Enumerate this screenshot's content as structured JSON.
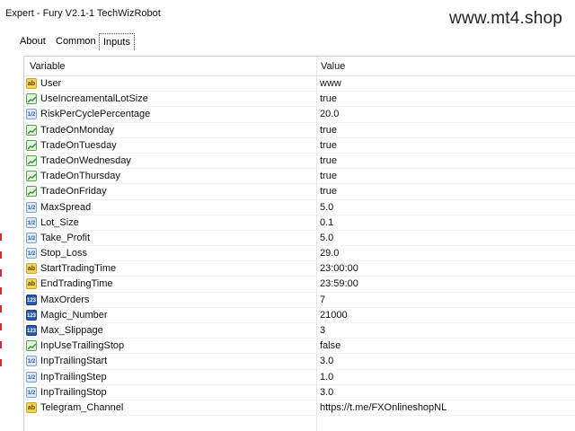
{
  "window": {
    "title": "Expert - Fury V2.1-1 TechWizRobot",
    "watermark": "www.mt4.shop"
  },
  "tabs": [
    {
      "label": "About"
    },
    {
      "label": "Common"
    },
    {
      "label": "Inputs",
      "active": true
    }
  ],
  "table": {
    "headers": {
      "variable": "Variable",
      "value": "Value"
    },
    "rows": [
      {
        "icon": "string-icon",
        "name": "User",
        "value": "www"
      },
      {
        "icon": "bool-icon",
        "name": "UseIncreamentalLotSize",
        "value": "true"
      },
      {
        "icon": "double-icon",
        "name": "RiskPerCyclePercentage",
        "value": "20.0"
      },
      {
        "icon": "bool-icon",
        "name": "TradeOnMonday",
        "value": "true"
      },
      {
        "icon": "bool-icon",
        "name": "TradeOnTuesday",
        "value": "true"
      },
      {
        "icon": "bool-icon",
        "name": "TradeOnWednesday",
        "value": "true"
      },
      {
        "icon": "bool-icon",
        "name": "TradeOnThursday",
        "value": "true"
      },
      {
        "icon": "bool-icon",
        "name": "TradeOnFriday",
        "value": "true"
      },
      {
        "icon": "double-icon",
        "name": "MaxSpread",
        "value": "5.0"
      },
      {
        "icon": "double-icon",
        "name": "Lot_Size",
        "value": "0.1"
      },
      {
        "icon": "double-icon",
        "name": "Take_Profit",
        "value": "5.0"
      },
      {
        "icon": "double-icon",
        "name": "Stop_Loss",
        "value": "29.0"
      },
      {
        "icon": "string-icon",
        "name": "StartTradingTime",
        "value": "23:00:00"
      },
      {
        "icon": "string-icon",
        "name": "EndTradingTime",
        "value": "23:59:00"
      },
      {
        "icon": "int-icon",
        "name": "MaxOrders",
        "value": "7"
      },
      {
        "icon": "int-icon",
        "name": "Magic_Number",
        "value": "21000"
      },
      {
        "icon": "int-icon",
        "name": "Max_Slippage",
        "value": "3"
      },
      {
        "icon": "bool-icon",
        "name": "InpUseTrailingStop",
        "value": "false"
      },
      {
        "icon": "double-icon",
        "name": "InpTrailingStart",
        "value": "3.0"
      },
      {
        "icon": "double-icon",
        "name": "InpTrailingStep",
        "value": "1.0"
      },
      {
        "icon": "double-icon",
        "name": "InpTrailingStop",
        "value": "3.0"
      },
      {
        "icon": "string-icon",
        "name": "Telegram_Channel",
        "value": "https://t.me/FXOnlineshopNL"
      }
    ]
  }
}
